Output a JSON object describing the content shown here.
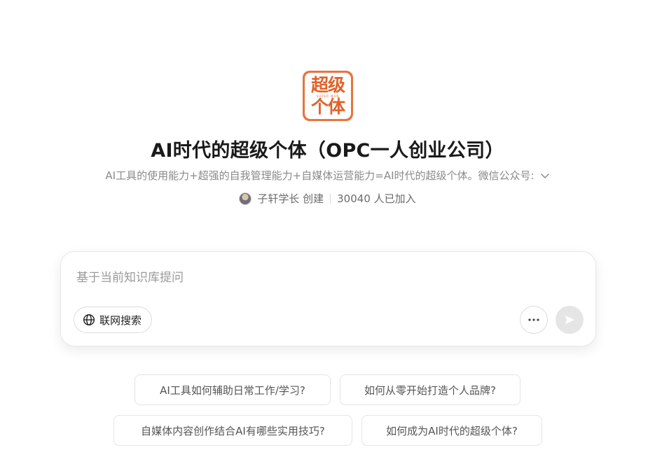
{
  "header": {
    "logo_line1": "超级",
    "logo_line2": "个体",
    "logo_small": "SUPER MAN",
    "title": "AI时代的超级个体（OPC一人创业公司）",
    "description": "AI工具的使用能力+超强的自我管理能力+自媒体运营能力=AI时代的超级个体。微信公众号:",
    "creator": "子轩学长 创建",
    "members": "30040 人已加入"
  },
  "input": {
    "placeholder": "基于当前知识库提问",
    "web_search_label": "联网搜索"
  },
  "suggestions": [
    "AI工具如何辅助日常工作/学习?",
    "如何从零开始打造个人品牌?",
    "自媒体内容创作结合AI有哪些实用技巧?",
    "如何成为AI时代的超级个体?"
  ],
  "colors": {
    "brand_orange": "#e0622a",
    "send_disabled": "#e5e5e5"
  }
}
